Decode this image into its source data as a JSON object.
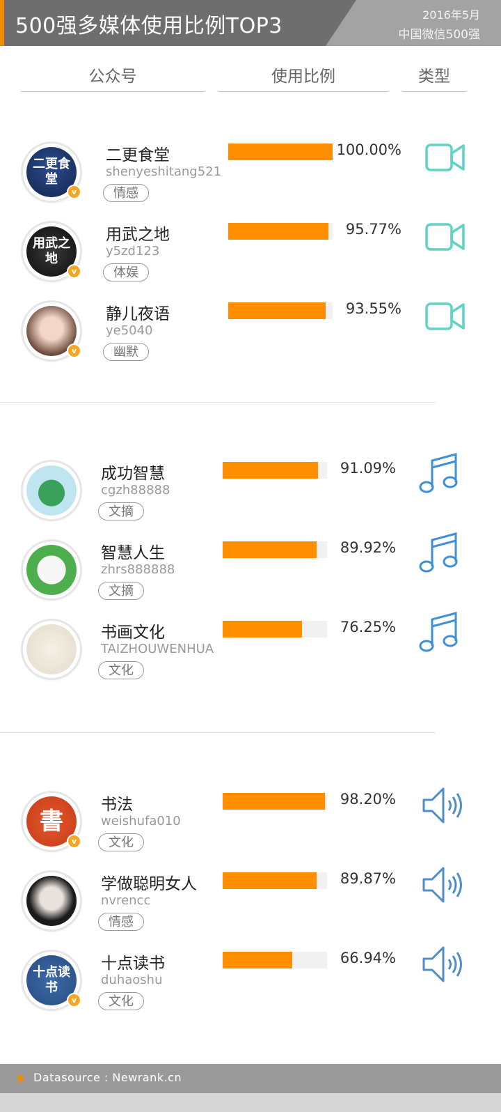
{
  "header": {
    "title": "500强多媒体使用比例TOP3",
    "date": "2016年5月",
    "subtitle": "中国微信500强"
  },
  "columns": {
    "account": "公众号",
    "ratio": "使用比例",
    "type": "类型"
  },
  "colors": {
    "bar": "#ff8f00",
    "video_icon": "#5fd3c4",
    "music_icon": "#3d8fd6",
    "audio_icon": "#4f8ec9",
    "accent": "#f08c00"
  },
  "chart_data": [
    {
      "type": "bar",
      "media_type": "video-icon",
      "categories": [
        "二更食堂",
        "用武之地",
        "静儿夜语"
      ],
      "values": [
        100.0,
        95.77,
        93.55
      ],
      "labels": [
        "100.00%",
        "95.77%",
        "93.55%"
      ],
      "ylim": [
        0,
        100
      ]
    },
    {
      "type": "bar",
      "media_type": "music-icon",
      "categories": [
        "成功智慧",
        "智慧人生",
        "书画文化"
      ],
      "values": [
        91.09,
        89.92,
        76.25
      ],
      "labels": [
        "91.09%",
        "89.92%",
        "76.25%"
      ],
      "ylim": [
        0,
        100
      ]
    },
    {
      "type": "bar",
      "media_type": "speaker-icon",
      "categories": [
        "书法",
        "学做聪明女人",
        "十点读书"
      ],
      "values": [
        98.2,
        89.87,
        66.94
      ],
      "labels": [
        "98.20%",
        "89.87%",
        "66.94%"
      ],
      "ylim": [
        0,
        100
      ]
    }
  ],
  "groups": [
    {
      "rows": [
        {
          "name": "二更食堂",
          "id": "shenyeshitang521",
          "tag": "情感",
          "avatar_text": "二更食堂",
          "verified": "v"
        },
        {
          "name": "用武之地",
          "id": "y5zd123",
          "tag": "体娱",
          "avatar_text": "用武之地",
          "verified": "v"
        },
        {
          "name": "静儿夜语",
          "id": "ye5040",
          "tag": "幽默",
          "avatar_text": "",
          "verified": "v"
        }
      ]
    },
    {
      "rows": [
        {
          "name": "成功智慧",
          "id": "cgzh88888",
          "tag": "文摘",
          "avatar_text": "",
          "verified": ""
        },
        {
          "name": "智慧人生",
          "id": "zhrs888888",
          "tag": "文摘",
          "avatar_text": "",
          "verified": ""
        },
        {
          "name": "书画文化",
          "id": "TAIZHOUWENHUA",
          "tag": "文化",
          "avatar_text": "",
          "verified": ""
        }
      ]
    },
    {
      "rows": [
        {
          "name": "书法",
          "id": "weishufa010",
          "tag": "文化",
          "avatar_text": "書",
          "verified": "v"
        },
        {
          "name": "学做聪明女人",
          "id": "nvrencc",
          "tag": "情感",
          "avatar_text": "",
          "verified": ""
        },
        {
          "name": "十点读书",
          "id": "duhaoshu",
          "tag": "文化",
          "avatar_text": "十点读书",
          "verified": "v"
        }
      ]
    }
  ],
  "footer": {
    "source": "Datasource : Newrank.cn"
  }
}
